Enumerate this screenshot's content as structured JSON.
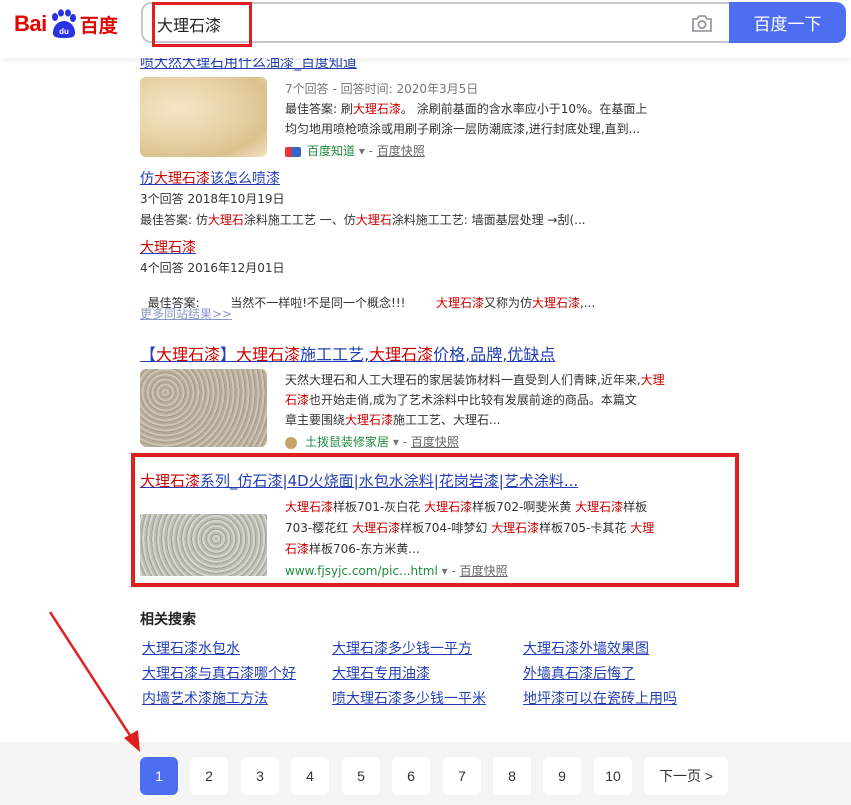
{
  "header": {
    "logo": {
      "bai": "Bai",
      "du": "du",
      "cn": "百度"
    },
    "search_value": "大理石漆",
    "search_button": "百度一下",
    "colors": {
      "brand_red": "#e10601",
      "button_blue": "#4e6ef2"
    }
  },
  "results": {
    "cut_title": "喷大然大理石用什么油漆_百度知道",
    "zhidao": {
      "meta": "7个回答 - 回答时间: 2020年3月5日",
      "best_prefix": "最佳答案: 刷",
      "best_em": "大理石漆",
      "best_rest": "。 涂刷前基面的含水率应小于10%。在基面上",
      "line2": "均匀地用喷枪喷涂或用刷子刷涂一层防潮底漆,进行封底处理,直到...",
      "source": "百度知道",
      "snapshot": "百度快照"
    },
    "qa": [
      {
        "title_pre": "仿",
        "title_em": "大理石漆",
        "title_post": "该怎么喷漆",
        "meta": "3个回答  2018年10月19日",
        "answer_parts": [
          "最佳答案: 仿",
          "大理石",
          "涂料施工工艺 一、仿",
          "大理石",
          "涂料施工工艺: 墙面基层处理 →刮(..."
        ]
      },
      {
        "title_pre": "",
        "title_em": "大理石漆",
        "title_post": "",
        "meta": "4个回答  2016年12月01日",
        "answer_parts": [
          "最佳答案:        当然不一样啦!不是同一个概念!!!        ",
          "大理石漆",
          "又称为仿",
          "大理石漆",
          ",..."
        ]
      }
    ],
    "more_link": "更多同站结果>>",
    "result2": {
      "title_parts": [
        "【",
        "大理石漆",
        "】",
        "大理石漆",
        "施工工艺,",
        "大理石漆",
        "价格,品牌,优缺点"
      ],
      "line1_pre": "天然大理石和人工大理石的家居装饰材料一直受到人们青睐,近年来,",
      "line1_em": "大理",
      "line2_em": "石漆",
      "line2_rest": "也开始走俏,成为了艺术涂料中比较有发展前途的商品。本篇文",
      "line3_pre": "章主要围绕",
      "line3_em": "大理石漆",
      "line3_rest": "施工工艺、大理石...",
      "source": "土拨鼠装修家居",
      "snapshot": "百度快照"
    },
    "result3": {
      "title_em": "大理石漆",
      "title_rest": "系列_仿石漆|4D火烧面|水包水涂料|花岗岩漆|艺术涂料...",
      "l1": [
        [
          "大理石漆",
          true
        ],
        [
          "样板701-灰白花 ",
          false
        ],
        [
          "大理石漆",
          true
        ],
        [
          "样板702-啊斐米黄 ",
          false
        ],
        [
          "大理石漆",
          true
        ],
        [
          "样板",
          false
        ]
      ],
      "l2": [
        [
          "703-樱花红 ",
          false
        ],
        [
          "大理石漆",
          true
        ],
        [
          "样板704-啡梦幻 ",
          false
        ],
        [
          "大理石漆",
          true
        ],
        [
          "样板705-卡其花 ",
          false
        ],
        [
          "大理",
          true
        ]
      ],
      "l3": [
        [
          "石漆",
          true
        ],
        [
          "样板706-东方米黄...",
          false
        ]
      ],
      "url": "www.fjsyjc.com/pic...html",
      "snapshot": "百度快照"
    }
  },
  "related": {
    "heading": "相关搜索",
    "items": [
      "大理石漆水包水",
      "大理石漆多少钱一平方",
      "大理石漆外墙效果图",
      "大理石漆与真石漆哪个好",
      "大理石专用油漆",
      "外墙真石漆后悔了",
      "内墙艺术漆施工方法",
      "喷大理石漆多少钱一平米",
      "地坪漆可以在瓷砖上用吗"
    ]
  },
  "pagination": {
    "pages": [
      "1",
      "2",
      "3",
      "4",
      "5",
      "6",
      "7",
      "8",
      "9",
      "10"
    ],
    "current": "1",
    "next": "下一页 >"
  }
}
